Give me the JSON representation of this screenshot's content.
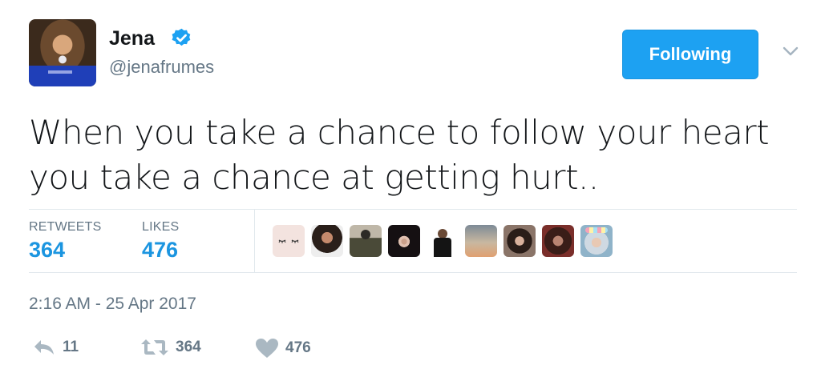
{
  "user": {
    "name": "Jena",
    "handle": "@jenafrumes"
  },
  "follow_button": {
    "label": "Following"
  },
  "tweet": {
    "text_line1": "When you take a chance to follow your heart",
    "text_line2": "you take a chance at getting hurt.."
  },
  "stats": {
    "retweets_label": "RETWEETS",
    "retweets_value": "364",
    "likes_label": "LIKES",
    "likes_value": "476"
  },
  "timestamp": "2:16 AM - 25 Apr 2017",
  "actions": {
    "reply_count": "11",
    "retweet_count": "364",
    "like_count": "476"
  },
  "colors": {
    "accent": "#1da1f2",
    "link": "#1b95e0",
    "muted": "#657786"
  }
}
